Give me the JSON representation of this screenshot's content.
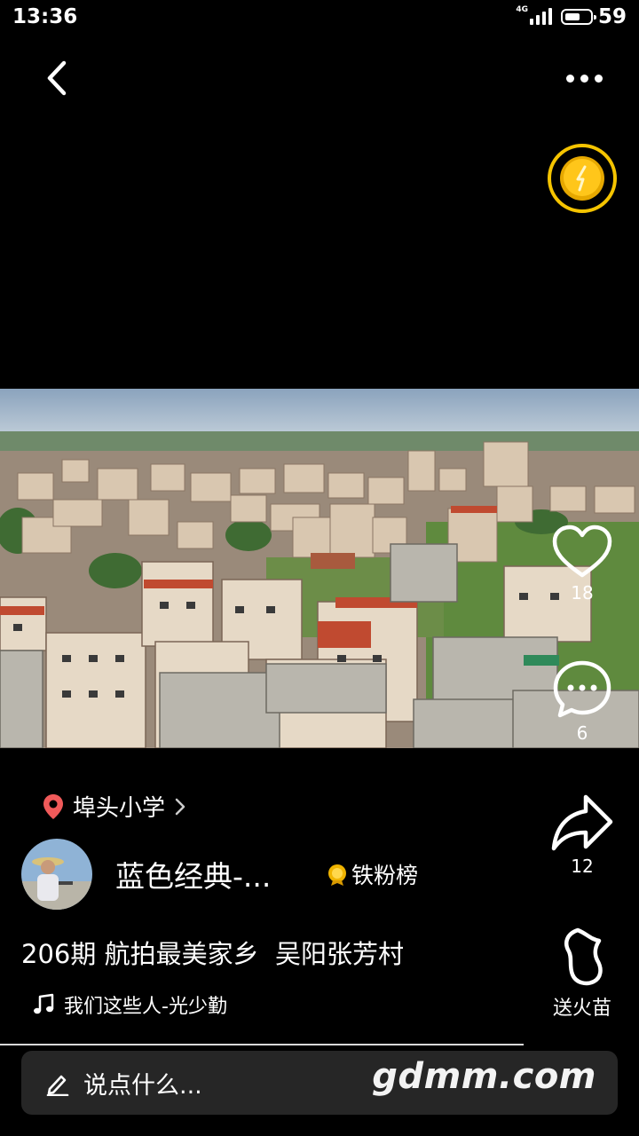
{
  "status_bar": {
    "time": "13:36",
    "network": "4G",
    "battery": "59"
  },
  "nav": {
    "back_icon": "chevron-left-icon",
    "more_icon": "more-dots-icon"
  },
  "reward": {
    "icon": "gold-coin-icon",
    "accent": "#f5c400"
  },
  "actions": {
    "like": {
      "icon": "heart-icon",
      "count": "18"
    },
    "comment": {
      "icon": "comment-bubble-icon",
      "count": "6"
    },
    "share": {
      "icon": "share-arrow-icon",
      "count": "12"
    },
    "fire": {
      "icon": "flame-icon",
      "label": "送火苗"
    }
  },
  "post": {
    "location": "埠头小学",
    "location_color": "#f05a5a",
    "author_name": "蓝色经典-...",
    "fan_badge": "铁粉榜",
    "caption": "206期 航拍最美家乡  吴阳张芳村",
    "music": "我们这些人-光少勤"
  },
  "comment_bar": {
    "placeholder": "说点什么...",
    "watermark": "gdmm.com"
  }
}
